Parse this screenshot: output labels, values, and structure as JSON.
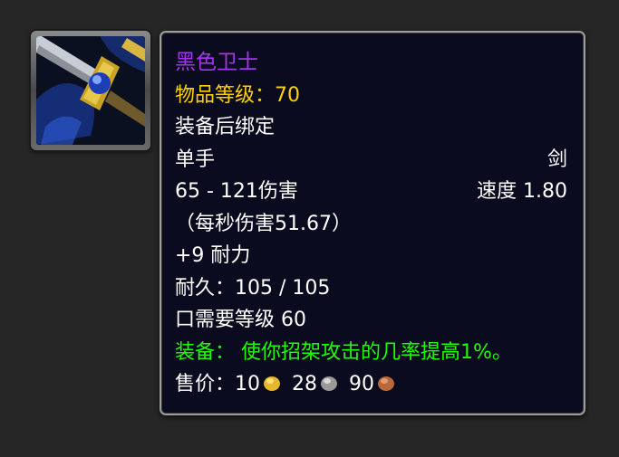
{
  "item": {
    "icon": "sword-item-icon",
    "name": "黑色卫士",
    "item_level": "物品等级：70",
    "binding": "装备后绑定",
    "slot": "单手",
    "weapon_type": "剑",
    "damage": "65 - 121伤害",
    "speed": "速度 1.80",
    "dps": "（每秒伤害51.67）",
    "stat": "+9 耐力",
    "durability": "耐久：105 / 105",
    "requirement": "口需要等级 60",
    "equip_effect": "装备：  使你招架攻击的几率提高1%。",
    "sell_label": "售价：",
    "sell_gold": "10",
    "sell_silver": "28",
    "sell_copper": "90"
  },
  "colors": {
    "item_name": "#a335ee",
    "item_level": "#ffd100",
    "equip_effect": "#1eff00",
    "tooltip_bg": "#0a0b1e",
    "tooltip_border": "#9c9c9c",
    "gold_coin": "#e8b82c",
    "silver_coin": "#9a9a9a",
    "copper_coin": "#b8683a"
  }
}
